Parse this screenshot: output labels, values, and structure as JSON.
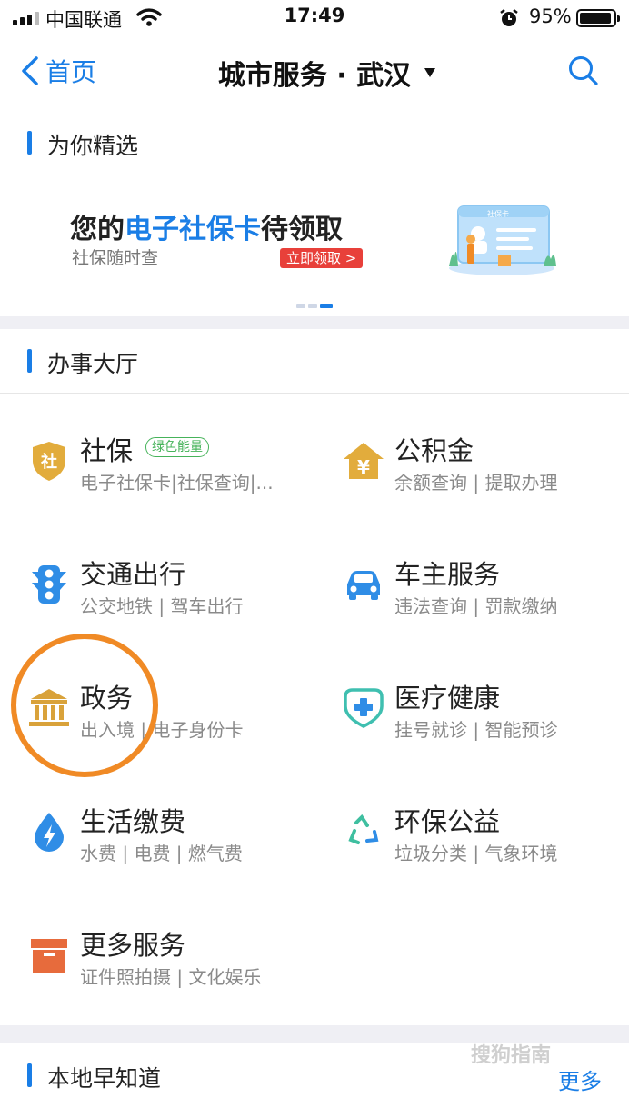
{
  "status_bar": {
    "carrier": "中国联通",
    "time": "17:49",
    "battery": "95%"
  },
  "nav": {
    "back_label": "首页",
    "title": "城市服务 · 武汉"
  },
  "featured": {
    "section_title": "为你精选",
    "banner": {
      "title_prefix": "您的",
      "title_highlight": "电子社保卡",
      "title_suffix": "待领取",
      "subtitle": "社保随时查",
      "cta": "立即领取 >",
      "card_label": "社保卡"
    }
  },
  "hall": {
    "section_title": "办事大厅",
    "services": [
      {
        "name": "社保",
        "tag": "绿色能量",
        "desc": "电子社保卡|社保查询|...",
        "icon": "shield-icon"
      },
      {
        "name": "公积金",
        "desc": "余额查询 | 提取办理",
        "icon": "house-yen-icon"
      },
      {
        "name": "交通出行",
        "desc": "公交地铁 | 驾车出行",
        "icon": "traffic-light-icon"
      },
      {
        "name": "车主服务",
        "desc": "违法查询 | 罚款缴纳",
        "icon": "car-icon"
      },
      {
        "name": "政务",
        "desc": "出入境 | 电子身份卡",
        "icon": "government-building-icon"
      },
      {
        "name": "医疗健康",
        "desc": "挂号就诊 | 智能预诊",
        "icon": "stethoscope-icon"
      },
      {
        "name": "生活缴费",
        "desc": "水费 | 电费 | 燃气费",
        "icon": "water-drop-icon"
      },
      {
        "name": "环保公益",
        "desc": "垃圾分类 | 气象环境",
        "icon": "recycle-icon"
      },
      {
        "name": "更多服务",
        "desc": "证件照拍摄 | 文化娱乐",
        "icon": "box-icon"
      }
    ]
  },
  "local": {
    "section_title": "本地早知道",
    "more": "更多"
  },
  "watermark": "搜狗指南",
  "colors": {
    "accent": "#1a7ee6",
    "highlight": "#f08a25",
    "green_tag": "#46b35a",
    "cta_red": "#e8403a"
  }
}
